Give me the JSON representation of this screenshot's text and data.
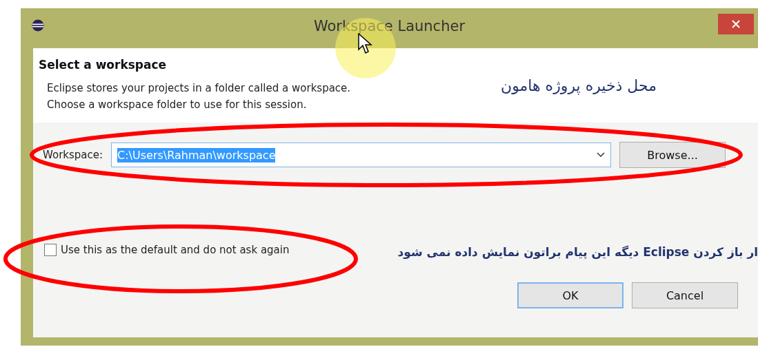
{
  "window": {
    "title": "Workspace Launcher"
  },
  "header": {
    "title": "Select a workspace",
    "description": [
      "Eclipse stores your projects in a folder called a workspace.",
      "Choose a workspace folder to use for this session."
    ]
  },
  "workspace": {
    "label": "Workspace:",
    "value": "C:\\Users\\Rahman\\workspace",
    "browse": "Browse..."
  },
  "checkbox": {
    "label": "Use this as the default and do not ask again",
    "checked": false
  },
  "buttons": [
    {
      "label": "OK",
      "default": true
    },
    {
      "label": "Cancel",
      "default": false
    }
  ],
  "annotations": [
    {
      "text": "محل ذخیره پروژه هامون",
      "bold": false
    },
    {
      "text": "ار باز کردن Eclipse دیگه این پیام براتون نمایش داده نمی شود",
      "bold": true
    }
  ]
}
